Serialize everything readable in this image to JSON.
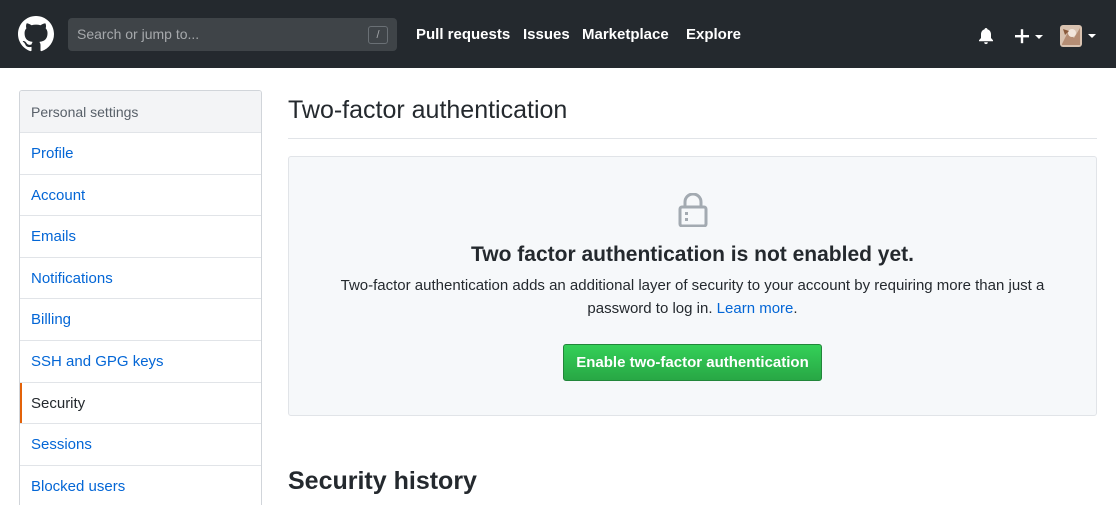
{
  "header": {
    "search_placeholder": "Search or jump to...",
    "search_shortcut": "/",
    "nav": [
      "Pull requests",
      "Issues",
      "Marketplace",
      "Explore"
    ]
  },
  "sidebar": {
    "heading": "Personal settings",
    "items": [
      {
        "label": "Profile"
      },
      {
        "label": "Account"
      },
      {
        "label": "Emails"
      },
      {
        "label": "Notifications"
      },
      {
        "label": "Billing"
      },
      {
        "label": "SSH and GPG keys"
      },
      {
        "label": "Security",
        "selected": true
      },
      {
        "label": "Sessions"
      },
      {
        "label": "Blocked users"
      }
    ]
  },
  "main": {
    "title": "Two-factor authentication",
    "blankslate": {
      "icon": "lock-icon",
      "heading": "Two factor authentication is not enabled yet.",
      "description_line1": "Two-factor authentication adds an additional layer of security to your account by requiring more than just a",
      "description_line2": "password to log in.",
      "learn_more": "Learn more",
      "period": ".",
      "button": "Enable two-factor authentication"
    },
    "section_title": "Security history"
  },
  "colors": {
    "header_bg": "#24292e",
    "link": "#0366d6",
    "button_green": "#28a745",
    "selected_accent": "#e36209"
  }
}
